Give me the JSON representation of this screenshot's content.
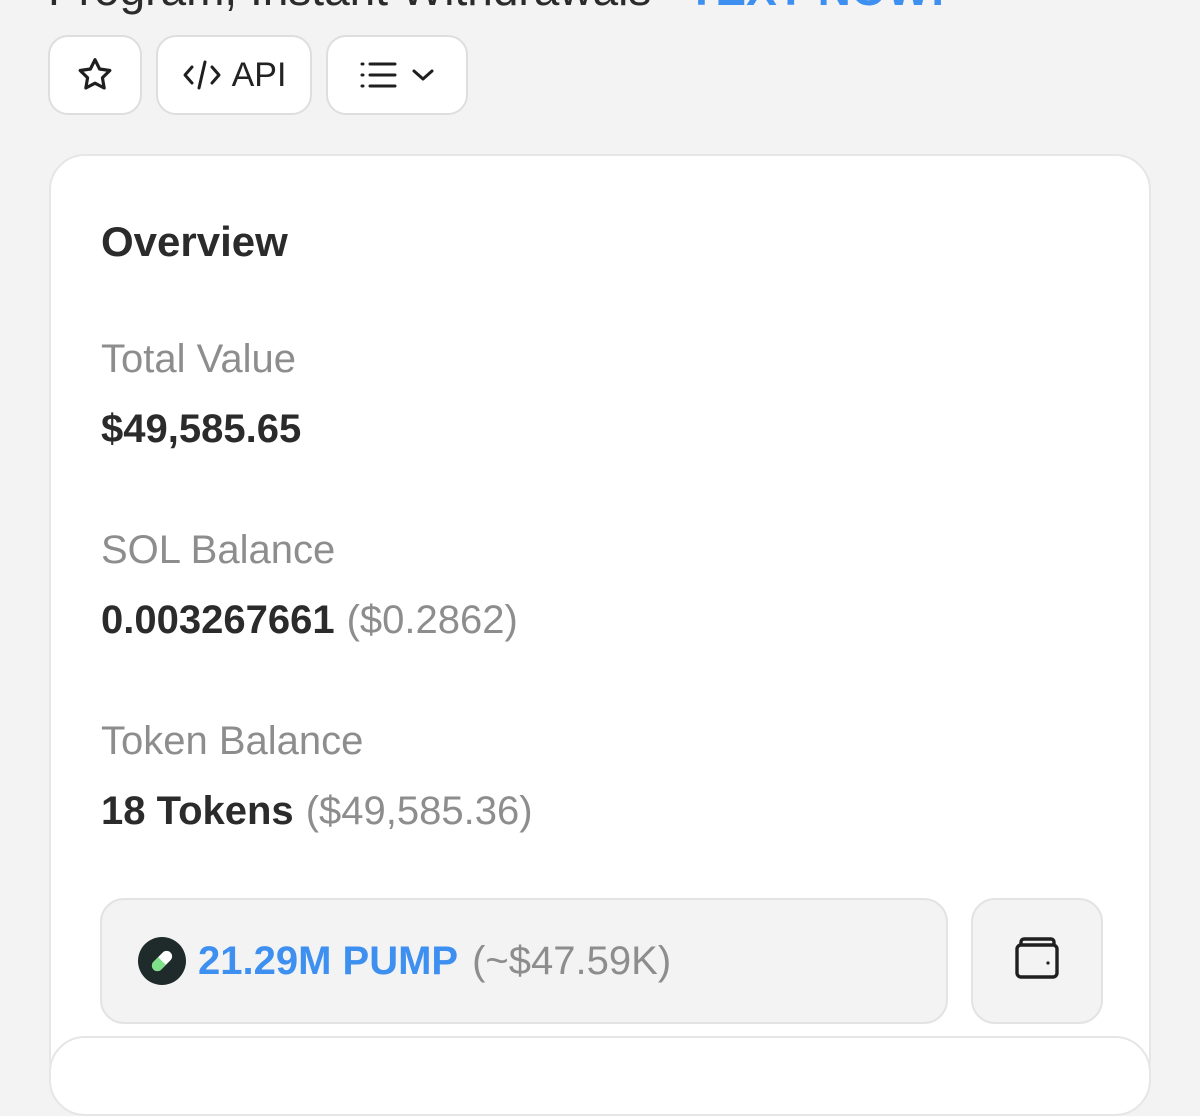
{
  "banner": {
    "text": "Program, Instant Withdrawals",
    "link": "TEXT NOW!"
  },
  "toolbar": {
    "api_label": "API",
    "icons": {
      "favorite": "star-icon",
      "api": "code-icon",
      "menu": "list-icon",
      "menu_caret": "chevron-down-icon"
    }
  },
  "overview": {
    "title": "Overview",
    "total_value": {
      "label": "Total Value",
      "value": "$49,585.65"
    },
    "sol_balance": {
      "label": "SOL Balance",
      "value": "0.003267661",
      "usd": "($0.2862)"
    },
    "token_balance": {
      "label": "Token Balance",
      "value": "18 Tokens",
      "usd": "($49,585.36)"
    },
    "top_token": {
      "amount": "21.29M PUMP",
      "usd": "(~$47.59K)",
      "icon": "pill-icon"
    },
    "wallet_icon": "wallet-icon"
  },
  "colors": {
    "accent": "#3d8ff0",
    "background": "#f3f3f4",
    "card": "#ffffff",
    "muted_text": "#8d8d8d",
    "primary_text": "#2b2b2b"
  }
}
